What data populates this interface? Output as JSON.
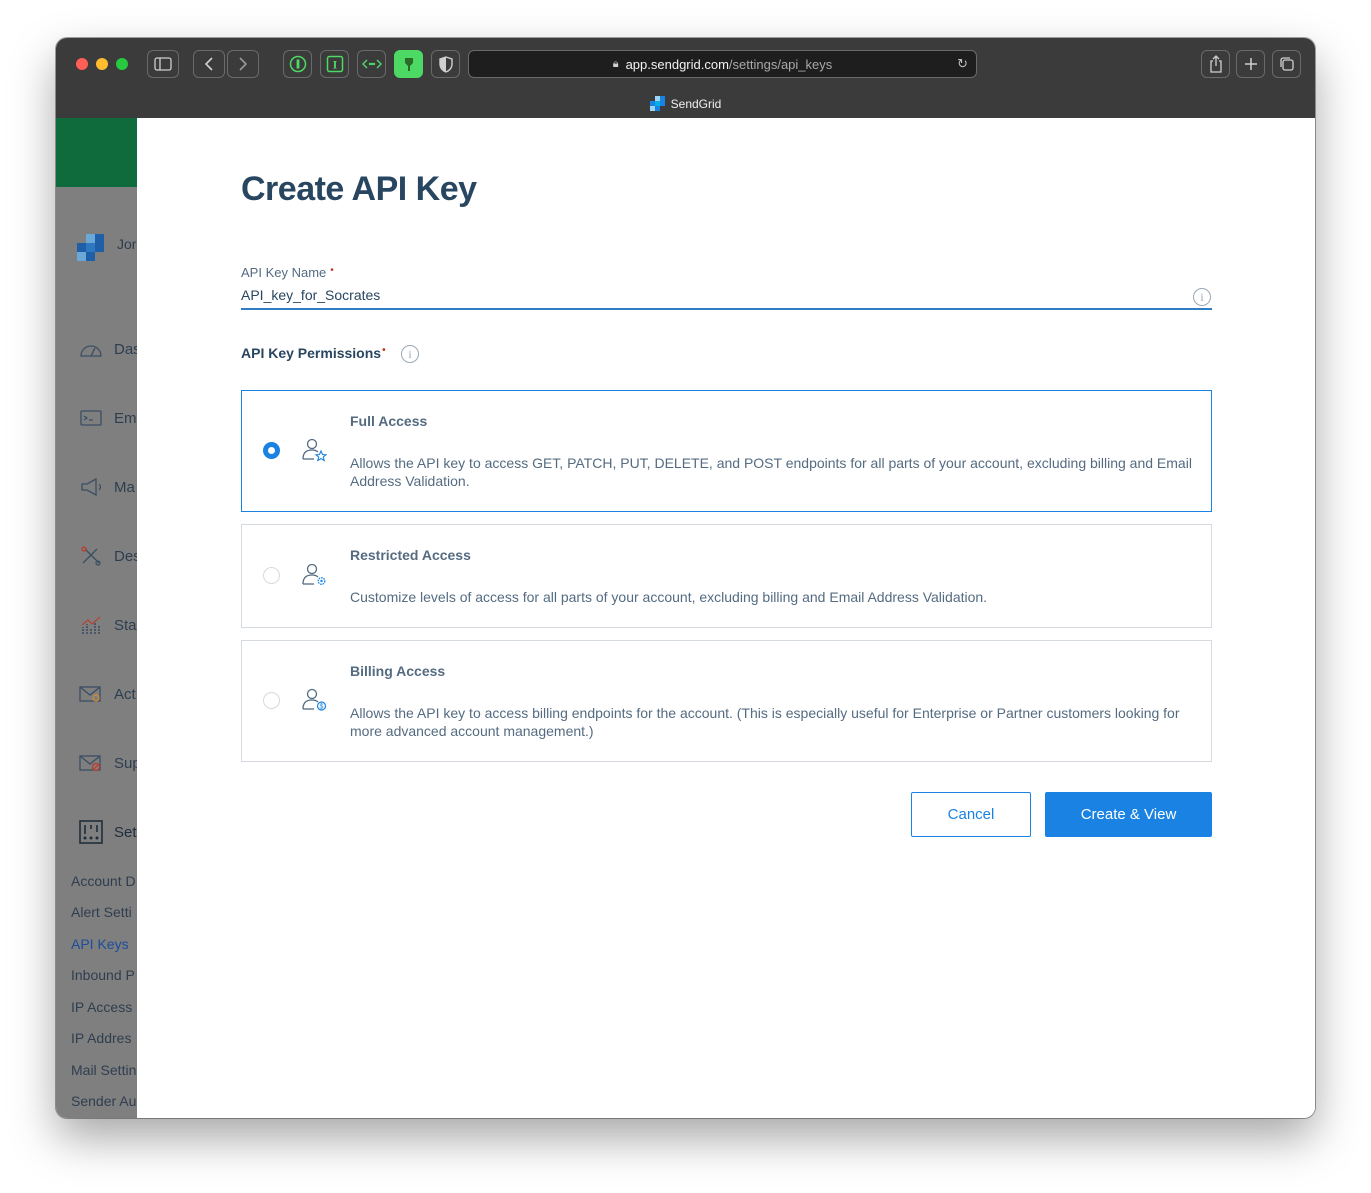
{
  "browser": {
    "url_host": "app.sendgrid.com",
    "url_path": "/settings/api_keys",
    "tab_title": "SendGrid"
  },
  "sidebar": {
    "user": "Jor",
    "items": [
      {
        "icon": "dashboard-icon",
        "label": "Das"
      },
      {
        "icon": "email-api-icon",
        "label": "Em"
      },
      {
        "icon": "megaphone-icon",
        "label": "Ma"
      },
      {
        "icon": "design-icon",
        "label": "Des"
      },
      {
        "icon": "stats-icon",
        "label": "Sta"
      },
      {
        "icon": "activity-icon",
        "label": "Act"
      },
      {
        "icon": "suppressions-icon",
        "label": "Sup"
      },
      {
        "icon": "settings-icon",
        "label": "Set"
      }
    ],
    "sub_items": [
      {
        "label": "Account D",
        "active": false
      },
      {
        "label": "Alert Setti",
        "active": false
      },
      {
        "label": "API Keys",
        "active": true
      },
      {
        "label": "Inbound P",
        "active": false
      },
      {
        "label": "IP Access",
        "active": false
      },
      {
        "label": "IP Addres",
        "active": false
      },
      {
        "label": "Mail Settin",
        "active": false
      },
      {
        "label": "Sender Au",
        "active": false
      }
    ]
  },
  "page": {
    "title": "Create API Key",
    "name_field": {
      "label": "API Key Name",
      "required_mark": "•",
      "value": "API_key_for_Socrates"
    },
    "permissions_label": "API Key Permissions",
    "permissions_required_mark": "•",
    "options": [
      {
        "title": "Full Access",
        "description": "Allows the API key to access GET, PATCH, PUT, DELETE, and POST endpoints for all parts of your account, excluding billing and Email Address Validation.",
        "selected": true,
        "icon": "user-star-icon"
      },
      {
        "title": "Restricted Access",
        "description": "Customize levels of access for all parts of your account, excluding billing and Email Address Validation.",
        "selected": false,
        "icon": "user-gear-icon"
      },
      {
        "title": "Billing Access",
        "description": "Allows the API key to access billing endpoints for the account. (This is especially useful for Enterprise or Partner customers looking for more advanced account management.)",
        "selected": false,
        "icon": "user-dollar-icon"
      }
    ],
    "cancel_label": "Cancel",
    "create_label": "Create & View"
  },
  "colors": {
    "accent": "#1a82e2",
    "heading": "#294661",
    "sidebar_green": "#0f6b3b"
  }
}
